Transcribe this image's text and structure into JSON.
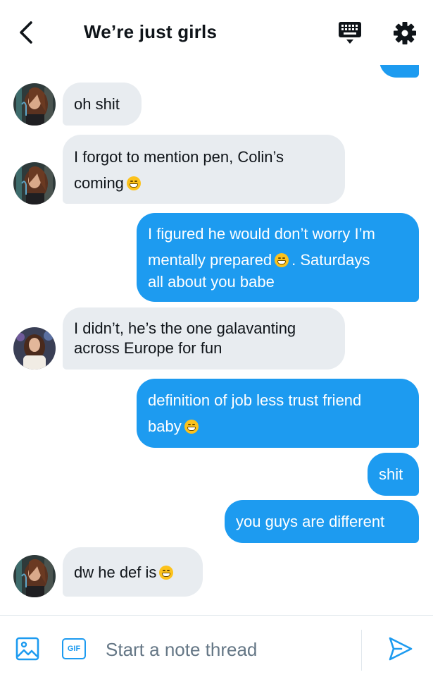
{
  "header": {
    "title": "We’re just girls",
    "back_icon": "chevron-left-icon",
    "keyboard_icon": "keyboard-icon",
    "settings_icon": "gear-icon"
  },
  "messages": [
    {
      "dir": "in",
      "avatar": "avatar-a",
      "lines": [
        "oh shit"
      ]
    },
    {
      "dir": "in",
      "avatar": "avatar-a",
      "lines": [
        "I forgot to mention pen, Colin’s",
        "coming"
      ],
      "emoji": "grimace-emoji"
    },
    {
      "dir": "out",
      "lines": [
        "I figured he would don’t worry I’m",
        "mentally prepared",
        ". Saturdays",
        "all about you babe"
      ],
      "emoji": "joy-emoji"
    },
    {
      "dir": "in",
      "avatar": "avatar-b",
      "lines": [
        "I didn’t, he’s the one galavanting",
        "across Europe for fun"
      ]
    },
    {
      "dir": "out",
      "lines": [
        "definition of job less trust friend",
        "baby"
      ],
      "emoji": "joy-emoji"
    },
    {
      "dir": "out",
      "lines": [
        "shit"
      ]
    },
    {
      "dir": "out",
      "lines": [
        "you guys are different"
      ]
    },
    {
      "dir": "in",
      "avatar": "avatar-a",
      "lines": [
        "dw he def is"
      ],
      "emoji": "joy-emoji"
    }
  ],
  "composer": {
    "placeholder": "Start a note thread",
    "gif_label": "GIF",
    "image_icon": "image-icon",
    "send_icon": "send-icon"
  },
  "colors": {
    "accent": "#1d9bf0",
    "incoming_bubble": "#e8ecf0",
    "outgoing_text": "#ffffff"
  }
}
